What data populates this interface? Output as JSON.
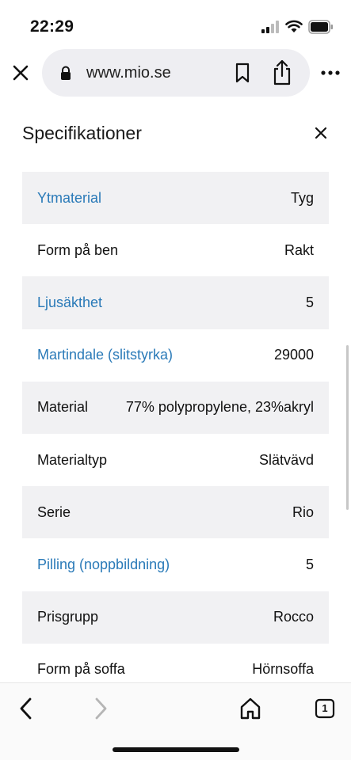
{
  "status_bar": {
    "time": "22:29",
    "icons": [
      "signal-icon",
      "wifi-icon",
      "battery-icon"
    ]
  },
  "browser": {
    "url": "www.mio.se",
    "icons": [
      "close-icon",
      "lock-icon",
      "bookmark-icon",
      "share-icon",
      "more-icon"
    ]
  },
  "panel": {
    "title": "Specifikationer",
    "rows": [
      {
        "label": "Ytmaterial",
        "value": "Tyg"
      },
      {
        "label": "Form på ben",
        "value": "Rakt"
      },
      {
        "label": "Ljusäkthet",
        "value": "5"
      },
      {
        "label": "Martindale (slitstyrka)",
        "value": "29000"
      },
      {
        "label": "Material",
        "value": "77% polypropylene, 23%akryl"
      },
      {
        "label": "Materialtyp",
        "value": "Slätvävd"
      },
      {
        "label": "Serie",
        "value": "Rio"
      },
      {
        "label": "Pilling (noppbildning)",
        "value": "5"
      },
      {
        "label": "Prisgrupp",
        "value": "Rocco"
      },
      {
        "label": "Form på soffa",
        "value": "Hörnsoffa"
      }
    ]
  },
  "bottom_bar": {
    "tab_count": "1",
    "icons": [
      "back-icon",
      "forward-icon",
      "home-icon",
      "tabs-icon"
    ]
  },
  "colors": {
    "link": "#2a7ab8",
    "row_shade": "#f1f1f3",
    "url_pill": "#eeeef2"
  }
}
